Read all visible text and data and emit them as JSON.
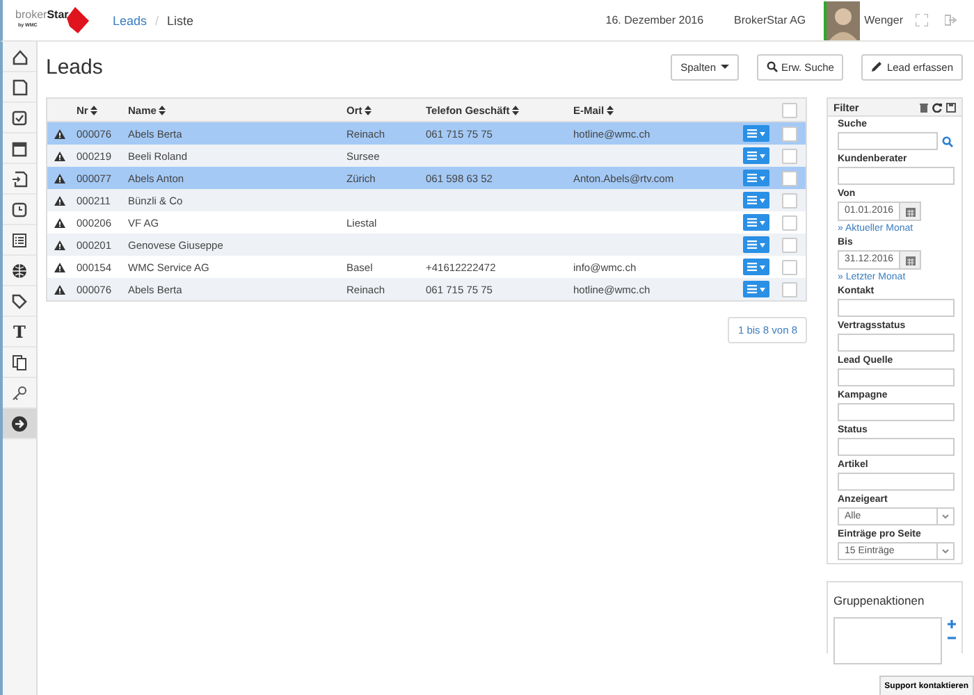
{
  "header": {
    "logo": {
      "word1": "broker",
      "word2": "Star",
      "tagline": "by WMC"
    },
    "breadcrumb": [
      "Leads",
      "Liste"
    ],
    "breadcrumb_separator": "/",
    "date": "16. Dezember 2016",
    "company": "BrokerStar AG",
    "user": "Wenger"
  },
  "sidebar": {
    "items": [
      {
        "kind": "home",
        "selected": false
      },
      {
        "kind": "document",
        "selected": false
      },
      {
        "kind": "checkbox",
        "selected": false
      },
      {
        "kind": "calendar",
        "selected": false
      },
      {
        "kind": "document-arrow",
        "selected": false
      },
      {
        "kind": "clock",
        "selected": false
      },
      {
        "kind": "list",
        "selected": false
      },
      {
        "kind": "globe",
        "selected": false
      },
      {
        "kind": "tag",
        "selected": false
      },
      {
        "kind": "glyph",
        "text": "T",
        "selected": false
      },
      {
        "kind": "copy",
        "selected": false
      },
      {
        "kind": "key",
        "selected": false
      },
      {
        "kind": "arrow-circle",
        "selected": true
      }
    ]
  },
  "page": {
    "title": "Leads",
    "buttons": [
      {
        "kind": "dropdown",
        "label": "Spalten"
      },
      {
        "kind": "search",
        "label": "Erw. Suche"
      },
      {
        "kind": "pencil",
        "label": "Lead erfassen"
      }
    ]
  },
  "table": {
    "columns": [
      "Nr",
      "Name",
      "Ort",
      "Telefon Geschäft",
      "E-Mail"
    ],
    "all_checked": false,
    "rows": [
      {
        "cells": [
          "000076",
          "Abels Berta",
          "Reinach",
          "061 715 75 75",
          "hotline@wmc.ch"
        ],
        "selected": true,
        "checked": false
      },
      {
        "cells": [
          "000219",
          "Beeli Roland",
          "Sursee",
          "",
          ""
        ],
        "selected": false,
        "checked": false
      },
      {
        "cells": [
          "000077",
          "Abels Anton",
          "Zürich",
          "061 598 63 52",
          "Anton.Abels@rtv.com"
        ],
        "selected": true,
        "checked": false
      },
      {
        "cells": [
          "000211",
          "Bünzli & Co",
          "",
          "",
          ""
        ],
        "selected": false,
        "checked": false
      },
      {
        "cells": [
          "000206",
          "VF AG",
          "Liestal",
          "",
          ""
        ],
        "selected": false,
        "checked": false
      },
      {
        "cells": [
          "000201",
          "Genovese Giuseppe",
          "",
          "",
          ""
        ],
        "selected": false,
        "checked": false
      },
      {
        "cells": [
          "000154",
          "WMC Service AG",
          "Basel",
          "+41612222472",
          "info@wmc.ch"
        ],
        "selected": false,
        "checked": false
      },
      {
        "cells": [
          "000076",
          "Abels Berta",
          "Reinach",
          "061 715 75 75",
          "hotline@wmc.ch"
        ],
        "selected": false,
        "checked": false
      }
    ],
    "pager": "1 bis 8 von 8"
  },
  "filter": {
    "title": "Filter",
    "fields": [
      {
        "kind": "search",
        "label": "Suche"
      },
      {
        "kind": "text",
        "label": "Kundenberater"
      },
      {
        "kind": "date",
        "label": "Von",
        "value": "01.01.2016",
        "link": "» Aktueller Monat"
      },
      {
        "kind": "date",
        "label": "Bis",
        "value": "31.12.2016",
        "link": "» Letzter Monat"
      },
      {
        "kind": "text",
        "label": "Kontakt"
      },
      {
        "kind": "text",
        "label": "Vertragsstatus"
      },
      {
        "kind": "text",
        "label": "Lead Quelle"
      },
      {
        "kind": "text",
        "label": "Kampagne"
      },
      {
        "kind": "text",
        "label": "Status"
      },
      {
        "kind": "text",
        "label": "Artikel"
      },
      {
        "kind": "select",
        "label": "Anzeigeart",
        "value": "Alle"
      },
      {
        "kind": "select",
        "label": "Einträge pro Seite",
        "value": "15 Einträge"
      }
    ]
  },
  "group_actions": {
    "title": "Gruppenaktionen"
  },
  "support": "Support kontaktieren"
}
